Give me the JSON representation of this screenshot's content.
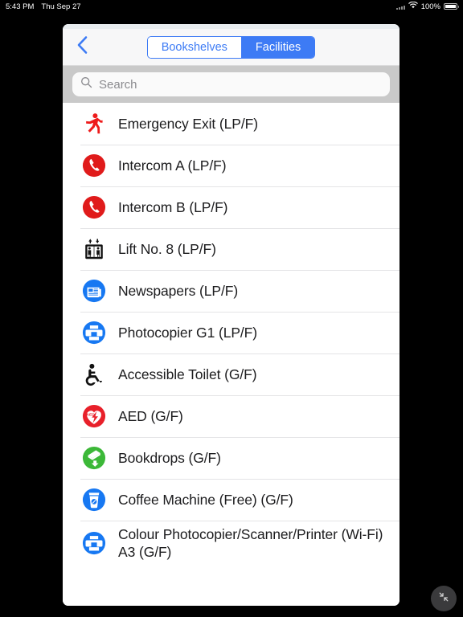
{
  "statusbar": {
    "time": "5:43 PM",
    "date": "Thu Sep 27",
    "battery_percent": "100%",
    "wifi_icon": "wifi-icon",
    "battery_icon": "battery-icon"
  },
  "navbar": {
    "back_icon": "chevron-left-icon",
    "segments": [
      {
        "label": "Bookshelves",
        "selected": false
      },
      {
        "label": "Facilities",
        "selected": true
      }
    ]
  },
  "search": {
    "placeholder": "Search",
    "value": "",
    "icon": "search-icon"
  },
  "list": {
    "items": [
      {
        "label": "Emergency Exit (LP/F)",
        "icon": "running-person-icon",
        "color": "#ee1b1b"
      },
      {
        "label": "Intercom A (LP/F)",
        "icon": "phone-circle-icon",
        "color": "#e01b1b"
      },
      {
        "label": "Intercom B (LP/F)",
        "icon": "phone-circle-icon",
        "color": "#e01b1b"
      },
      {
        "label": "Lift No. 8 (LP/F)",
        "icon": "elevator-icon",
        "color": "#111111"
      },
      {
        "label": "Newspapers (LP/F)",
        "icon": "newspaper-circle-icon",
        "color": "#1778f2"
      },
      {
        "label": "Photocopier G1 (LP/F)",
        "icon": "printer-circle-icon",
        "color": "#1778f2"
      },
      {
        "label": "Accessible Toilet (G/F)",
        "icon": "wheelchair-icon",
        "color": "#111111"
      },
      {
        "label": "AED (G/F)",
        "icon": "aed-circle-icon",
        "color": "#e8202a"
      },
      {
        "label": "Bookdrops (G/F)",
        "icon": "bookdrop-circle-icon",
        "color": "#3cb838"
      },
      {
        "label": "Coffee Machine (Free) (G/F)",
        "icon": "coffee-circle-icon",
        "color": "#1778f2"
      },
      {
        "label": "Colour Photocopier/Scanner/Printer (Wi-Fi) A3 (G/F)",
        "icon": "printer-circle-icon",
        "color": "#1778f2"
      }
    ]
  },
  "floating_button": {
    "icon": "collapse-arrows-icon",
    "color": "#3a3a3c"
  }
}
